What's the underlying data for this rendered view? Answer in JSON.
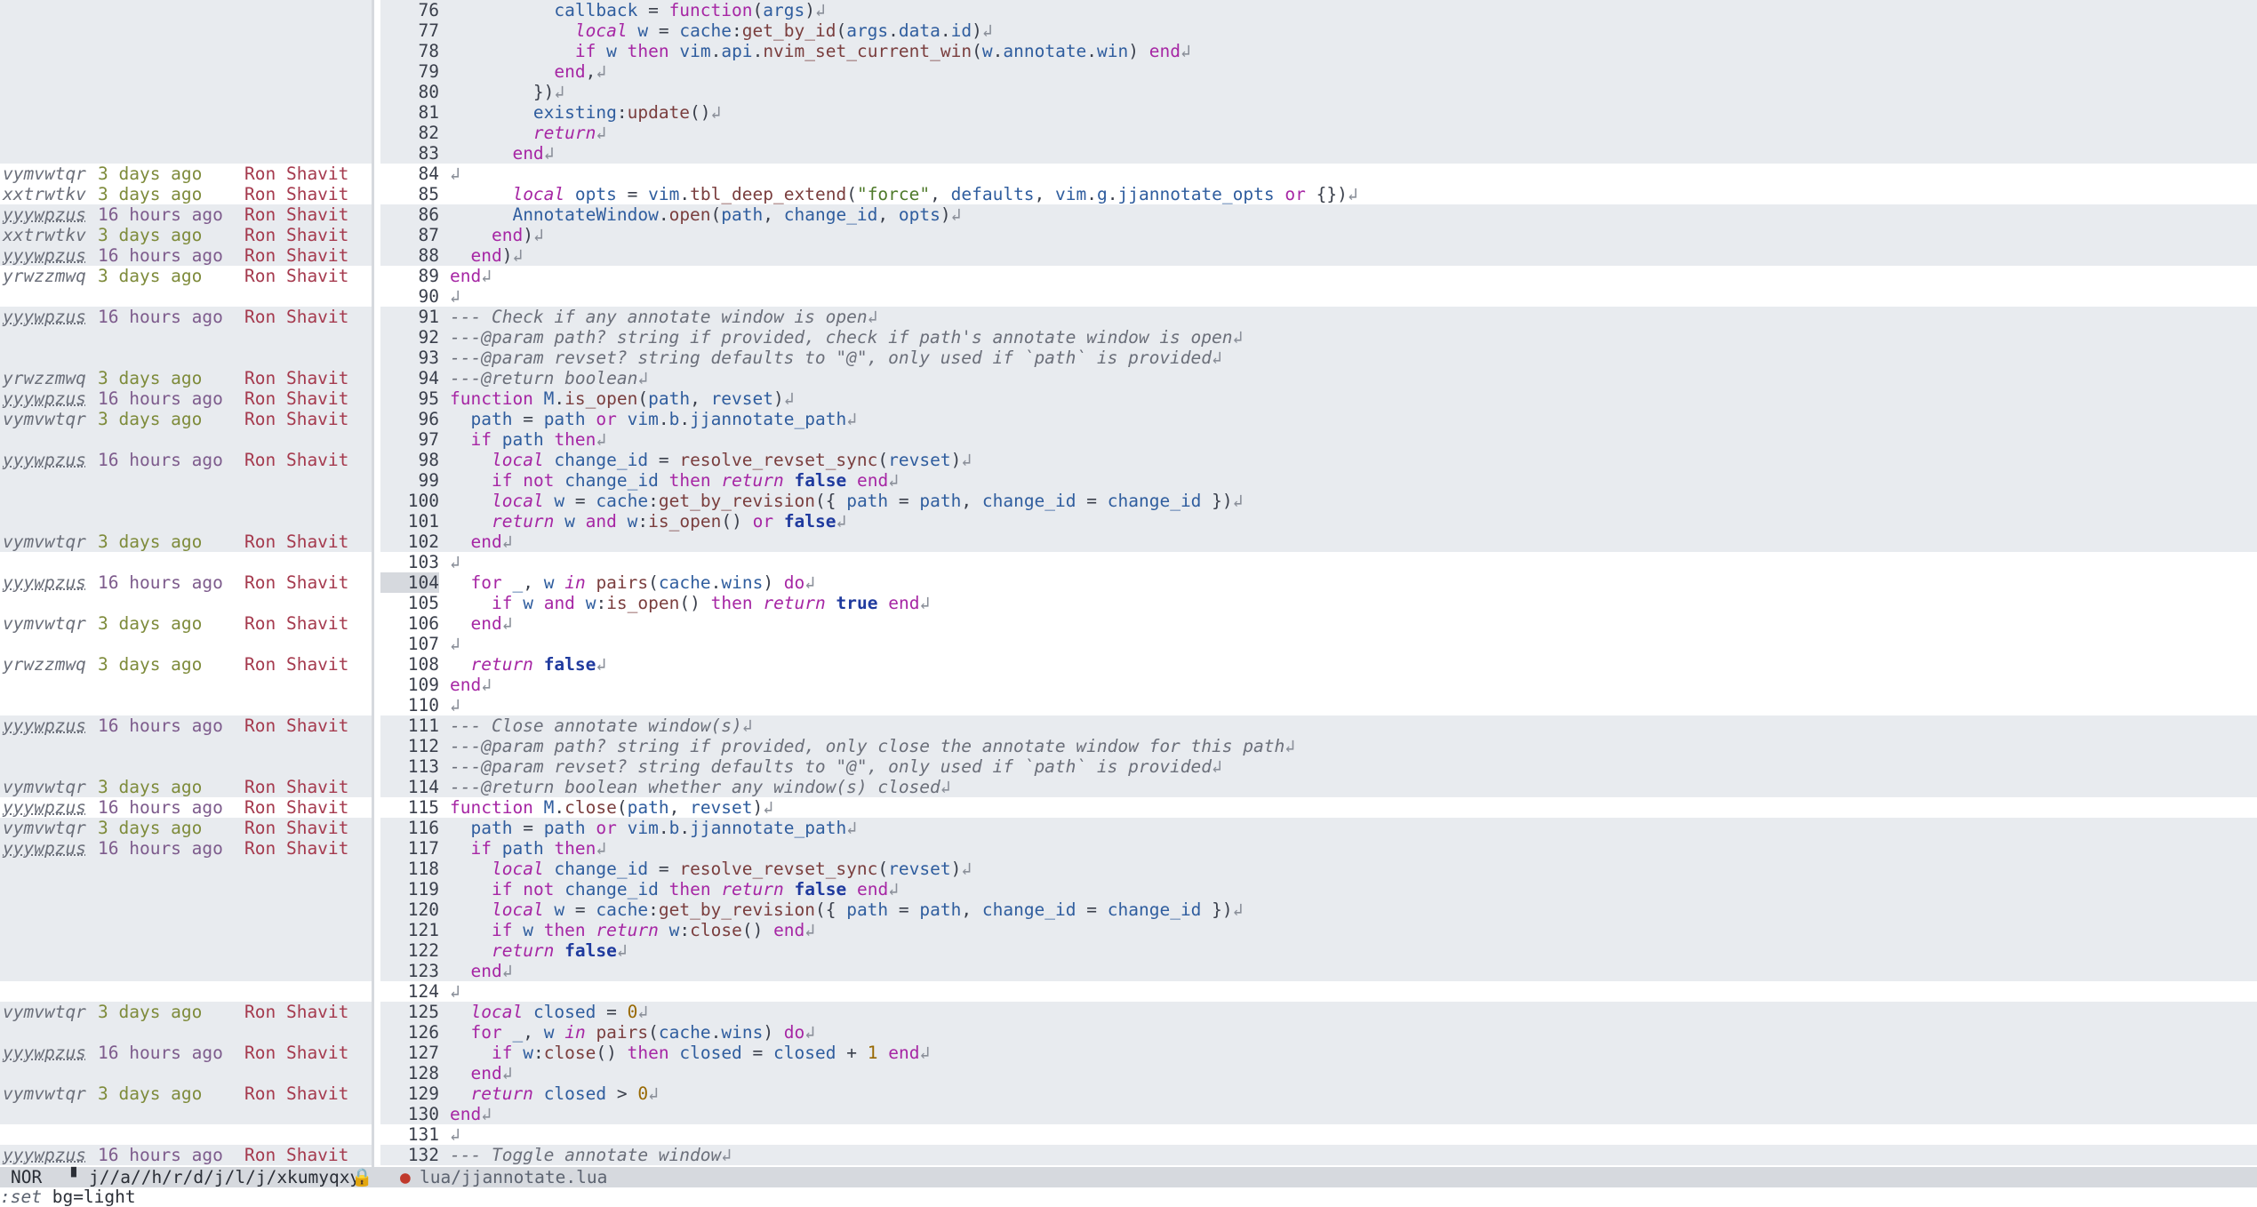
{
  "statusline": {
    "mode": "NOR",
    "buffer_path": "j//a//h/r/d/j/l/j/xkumyqxy",
    "file_name": "lua/jjannotate.lua",
    "path_icon": "file-icon",
    "lock_icon": "lock-icon",
    "git_icon": "git-icon"
  },
  "cmdline": {
    "prefix": ":set",
    "rest": " bg=light"
  },
  "colors": {
    "background": "#ffffff",
    "shade": "#e8ebef",
    "statusline": "#d6d9de"
  },
  "blame": [
    null,
    null,
    null,
    null,
    null,
    null,
    null,
    null,
    {
      "change_id": "vymvwtqr",
      "age": "3 days ago",
      "author": "Ron Shavit"
    },
    {
      "change_id": "xxtrwtkv",
      "age": "3 days ago",
      "author": "Ron Shavit"
    },
    {
      "change_id": "yyywpzus",
      "age": "16 hours ago",
      "author": "Ron Shavit"
    },
    {
      "change_id": "xxtrwtkv",
      "age": "3 days ago",
      "author": "Ron Shavit"
    },
    {
      "change_id": "yyywpzus",
      "age": "16 hours ago",
      "author": "Ron Shavit"
    },
    {
      "change_id": "yrwzzmwq",
      "age": "3 days ago",
      "author": "Ron Shavit"
    },
    null,
    {
      "change_id": "yyywpzus",
      "age": "16 hours ago",
      "author": "Ron Shavit"
    },
    null,
    null,
    {
      "change_id": "yrwzzmwq",
      "age": "3 days ago",
      "author": "Ron Shavit"
    },
    {
      "change_id": "yyywpzus",
      "age": "16 hours ago",
      "author": "Ron Shavit"
    },
    {
      "change_id": "vymvwtqr",
      "age": "3 days ago",
      "author": "Ron Shavit"
    },
    null,
    {
      "change_id": "yyywpzus",
      "age": "16 hours ago",
      "author": "Ron Shavit"
    },
    null,
    null,
    null,
    {
      "change_id": "vymvwtqr",
      "age": "3 days ago",
      "author": "Ron Shavit"
    },
    null,
    {
      "change_id": "yyywpzus",
      "age": "16 hours ago",
      "author": "Ron Shavit"
    },
    null,
    {
      "change_id": "vymvwtqr",
      "age": "3 days ago",
      "author": "Ron Shavit"
    },
    null,
    {
      "change_id": "yrwzzmwq",
      "age": "3 days ago",
      "author": "Ron Shavit"
    },
    null,
    null,
    {
      "change_id": "yyywpzus",
      "age": "16 hours ago",
      "author": "Ron Shavit"
    },
    null,
    null,
    {
      "change_id": "vymvwtqr",
      "age": "3 days ago",
      "author": "Ron Shavit"
    },
    {
      "change_id": "yyywpzus",
      "age": "16 hours ago",
      "author": "Ron Shavit"
    },
    {
      "change_id": "vymvwtqr",
      "age": "3 days ago",
      "author": "Ron Shavit"
    },
    {
      "change_id": "yyywpzus",
      "age": "16 hours ago",
      "author": "Ron Shavit"
    },
    null,
    null,
    null,
    null,
    null,
    null,
    null,
    {
      "change_id": "vymvwtqr",
      "age": "3 days ago",
      "author": "Ron Shavit"
    },
    null,
    {
      "change_id": "yyywpzus",
      "age": "16 hours ago",
      "author": "Ron Shavit"
    },
    null,
    {
      "change_id": "vymvwtqr",
      "age": "3 days ago",
      "author": "Ron Shavit"
    },
    null,
    null,
    {
      "change_id": "yyywpzus",
      "age": "16 hours ago",
      "author": "Ron Shavit"
    }
  ],
  "code": [
    {
      "n": "76",
      "t": "          callback = function(args)"
    },
    {
      "n": "77",
      "t": "            local w = cache:get_by_id(args.data.id)"
    },
    {
      "n": "78",
      "t": "            if w then vim.api.nvim_set_current_win(w.annotate.win) end"
    },
    {
      "n": "79",
      "t": "          end,"
    },
    {
      "n": "80",
      "t": "        })"
    },
    {
      "n": "81",
      "t": "        existing:update()"
    },
    {
      "n": "82",
      "t": "        return"
    },
    {
      "n": "83",
      "t": "      end"
    },
    {
      "n": "84",
      "t": ""
    },
    {
      "n": "85",
      "t": "      local opts = vim.tbl_deep_extend(\"force\", defaults, vim.g.jjannotate_opts or {})"
    },
    {
      "n": "86",
      "t": "      AnnotateWindow.open(path, change_id, opts)"
    },
    {
      "n": "87",
      "t": "    end)"
    },
    {
      "n": "88",
      "t": "  end)"
    },
    {
      "n": "89",
      "t": "end"
    },
    {
      "n": "90",
      "t": ""
    },
    {
      "n": "91",
      "t": "--- Check if any annotate window is open"
    },
    {
      "n": "92",
      "t": "---@param path? string if provided, check if path's annotate window is open"
    },
    {
      "n": "93",
      "t": "---@param revset? string defaults to \"@\", only used if `path` is provided"
    },
    {
      "n": "94",
      "t": "---@return boolean"
    },
    {
      "n": "95",
      "t": "function M.is_open(path, revset)"
    },
    {
      "n": "96",
      "t": "  path = path or vim.b.jjannotate_path"
    },
    {
      "n": "97",
      "t": "  if path then"
    },
    {
      "n": "98",
      "t": "    local change_id = resolve_revset_sync(revset)"
    },
    {
      "n": "99",
      "t": "    if not change_id then return false end"
    },
    {
      "n": "100",
      "t": "    local w = cache:get_by_revision({ path = path, change_id = change_id })"
    },
    {
      "n": "101",
      "t": "    return w and w:is_open() or false"
    },
    {
      "n": "102",
      "t": "  end"
    },
    {
      "n": "103",
      "t": ""
    },
    {
      "n": "104",
      "t": "  for _, w in pairs(cache.wins) do"
    },
    {
      "n": "105",
      "t": "    if w and w:is_open() then return true end"
    },
    {
      "n": "106",
      "t": "  end"
    },
    {
      "n": "107",
      "t": ""
    },
    {
      "n": "108",
      "t": "  return false"
    },
    {
      "n": "109",
      "t": "end"
    },
    {
      "n": "110",
      "t": ""
    },
    {
      "n": "111",
      "t": "--- Close annotate window(s)"
    },
    {
      "n": "112",
      "t": "---@param path? string if provided, only close the annotate window for this path"
    },
    {
      "n": "113",
      "t": "---@param revset? string defaults to \"@\", only used if `path` is provided"
    },
    {
      "n": "114",
      "t": "---@return boolean whether any window(s) closed"
    },
    {
      "n": "115",
      "t": "function M.close(path, revset)"
    },
    {
      "n": "116",
      "t": "  path = path or vim.b.jjannotate_path"
    },
    {
      "n": "117",
      "t": "  if path then"
    },
    {
      "n": "118",
      "t": "    local change_id = resolve_revset_sync(revset)"
    },
    {
      "n": "119",
      "t": "    if not change_id then return false end"
    },
    {
      "n": "120",
      "t": "    local w = cache:get_by_revision({ path = path, change_id = change_id })"
    },
    {
      "n": "121",
      "t": "    if w then return w:close() end"
    },
    {
      "n": "122",
      "t": "    return false"
    },
    {
      "n": "123",
      "t": "  end"
    },
    {
      "n": "124",
      "t": ""
    },
    {
      "n": "125",
      "t": "  local closed = 0"
    },
    {
      "n": "126",
      "t": "  for _, w in pairs(cache.wins) do"
    },
    {
      "n": "127",
      "t": "    if w:close() then closed = closed + 1 end"
    },
    {
      "n": "128",
      "t": "  end"
    },
    {
      "n": "129",
      "t": "  return closed > 0"
    },
    {
      "n": "130",
      "t": "end"
    },
    {
      "n": "131",
      "t": ""
    },
    {
      "n": "132",
      "t": "--- Toggle annotate window"
    }
  ],
  "eol_marker": "↲",
  "current_line": "104"
}
